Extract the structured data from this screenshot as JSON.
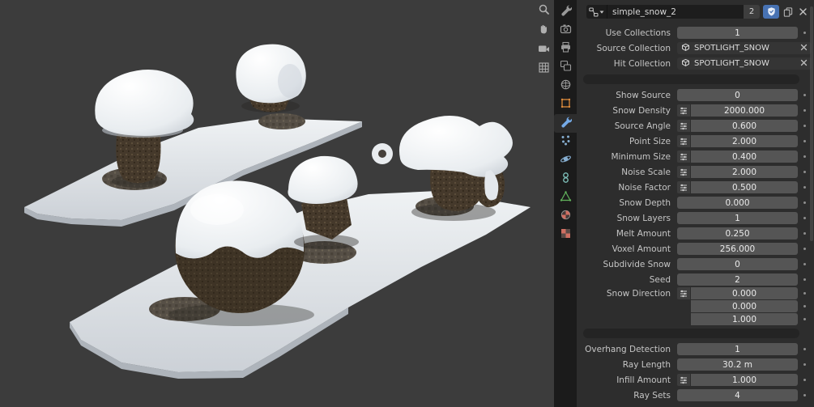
{
  "colors": {
    "accent_blue": "#4772b3",
    "viewport_bg": "#3c3c3c",
    "panel_bg": "#2d2d2d",
    "tabstrip_bg": "#1b1b1b",
    "number_field_bg": "#555555",
    "id_field_bg": "#1d1d1d",
    "active_modifier_icon": "#74a9e6",
    "object_tab_orange": "#dd8b3d",
    "data_tab_green": "#62b35c",
    "material_tab_red": "#cf6f62"
  },
  "icons": {
    "overlay": [
      "zoom-icon",
      "pan-hand-icon",
      "camera-view-icon",
      "grid-ortho-icon"
    ],
    "tabs": [
      "tool-icon",
      "render-icon",
      "output-icon",
      "view-layer-icon",
      "world-icon",
      "object-icon",
      "modifiers-wrench-icon",
      "particles-icon",
      "physics-icon",
      "constraints-icon",
      "object-data-icon",
      "material-icon",
      "texture-icon"
    ],
    "header": [
      "node-group-browse-icon",
      "fake-user-shield-icon",
      "copy-icon",
      "close-icon"
    ],
    "fields": [
      "collection-icon",
      "unlink-x-icon",
      "attribute-toggle-icon",
      "decorator-dot"
    ]
  },
  "panel": {
    "header": {
      "name": "simple_snow_2",
      "user_count": "2"
    },
    "rows": [
      {
        "label": "Use Collections",
        "value": "1"
      },
      {
        "label": "Source Collection",
        "value": "SPOTLIGHT_SNOW"
      },
      {
        "label": "Hit Collection",
        "value": "SPOTLIGHT_SNOW"
      },
      {
        "label": "Show Source",
        "value": "0"
      },
      {
        "label": "Snow Density",
        "value": "2000.000"
      },
      {
        "label": "Source Angle",
        "value": "0.600"
      },
      {
        "label": "Point Size",
        "value": "2.000"
      },
      {
        "label": "Minimum Size",
        "value": "0.400"
      },
      {
        "label": "Noise Scale",
        "value": "2.000"
      },
      {
        "label": "Noise Factor",
        "value": "0.500"
      },
      {
        "label": "Snow Depth",
        "value": "0.000"
      },
      {
        "label": "Snow Layers",
        "value": "1"
      },
      {
        "label": "Melt Amount",
        "value": "0.250"
      },
      {
        "label": "Voxel Amount",
        "value": "256.000"
      },
      {
        "label": "Subdivide Snow",
        "value": "0"
      },
      {
        "label": "Seed",
        "value": "2"
      },
      {
        "label": "Snow Direction",
        "values": [
          "0.000",
          "0.000",
          "1.000"
        ]
      },
      {
        "label": "Overhang Detection",
        "value": "1"
      },
      {
        "label": "Ray Length",
        "value": "30.2 m"
      },
      {
        "label": "Infill Amount",
        "value": "1.000"
      },
      {
        "label": "Ray Sets",
        "value": "4"
      }
    ]
  }
}
